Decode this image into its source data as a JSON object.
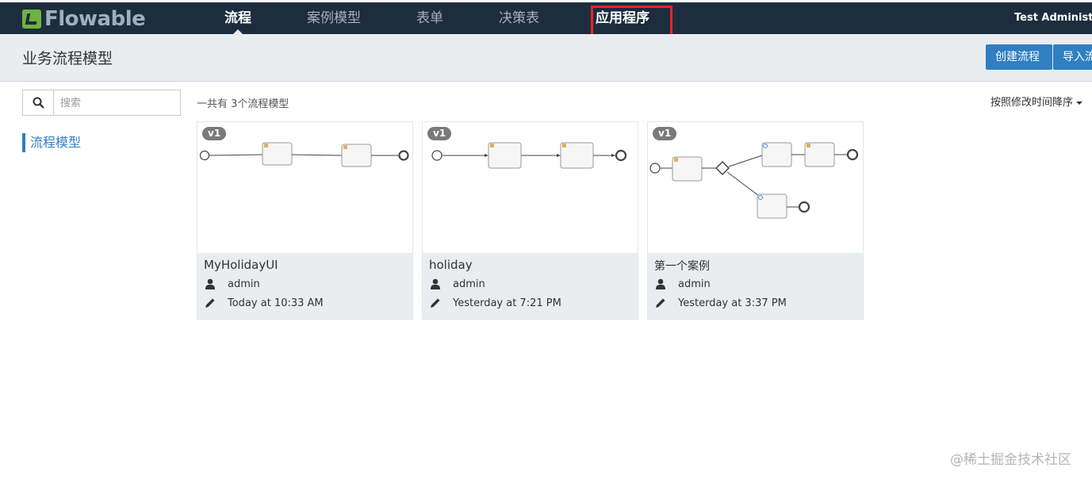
{
  "app": {
    "brand": "Flowable",
    "brand_color": "#6db33f",
    "accent": "#2f7fc1"
  },
  "nav": {
    "items": [
      {
        "label": "流程",
        "active": true
      },
      {
        "label": "案例模型",
        "active": false
      },
      {
        "label": "表单",
        "active": false
      },
      {
        "label": "决策表",
        "active": false
      },
      {
        "label": "应用程序",
        "active": false,
        "highlighted": true
      }
    ],
    "user": "Test Administrat"
  },
  "header": {
    "title": "业务流程模型",
    "create_label": "创建流程",
    "import_label": "导入流"
  },
  "sidebar": {
    "search_placeholder": "搜索",
    "items": [
      {
        "label": "流程模型",
        "active": true
      }
    ]
  },
  "main": {
    "count_text": "一共有 3个流程模型",
    "sort_label": "按照修改时间降序",
    "cards": [
      {
        "version": "v1",
        "name": "MyHolidayUI",
        "author": "admin",
        "modified": "Today at 10:33 AM"
      },
      {
        "version": "v1",
        "name": "holiday",
        "author": "admin",
        "modified": "Yesterday at 7:21 PM"
      },
      {
        "version": "v1",
        "name": "第一个案例",
        "author": "admin",
        "modified": "Yesterday at 3:37 PM"
      }
    ]
  },
  "watermark": "@稀土掘金技术社区"
}
